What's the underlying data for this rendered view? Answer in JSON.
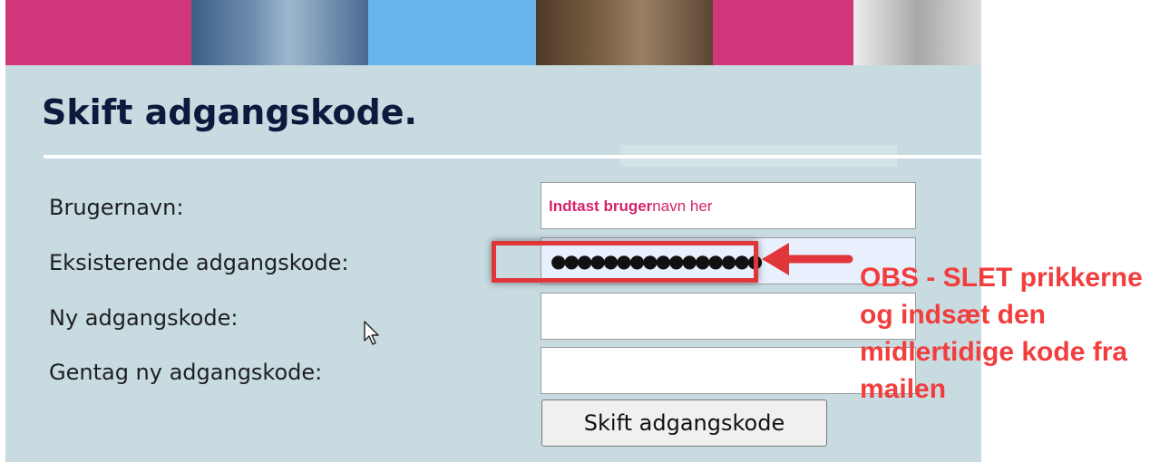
{
  "page": {
    "title": "Skift adgangskode."
  },
  "form": {
    "username": {
      "label": "Brugernavn:",
      "value_prefix": "Indtast bruger",
      "value_suffix": "navn her"
    },
    "current_password": {
      "label": "Eksisterende adgangskode:",
      "masked_value": "●●●●●●●●●●●●●●●●"
    },
    "new_password": {
      "label": "Ny adgangskode:",
      "value": ""
    },
    "repeat_password": {
      "label": "Gentag ny adgangskode:",
      "value": ""
    },
    "submit_label": "Skift adgangskode"
  },
  "annotation": {
    "note": "OBS - SLET prikkerne og indsæt den midlertidige kode fra mailen",
    "color": "#f23d3d"
  },
  "colors": {
    "panel_background": "#c7dbe1",
    "title": "#0d1a3d",
    "username_hint": "#d6226a",
    "banner_pink": "#d0377a",
    "banner_blue": "#68b4ec"
  },
  "icons": {
    "arrow": "arrow-left-icon",
    "cursor": "mouse-pointer-icon"
  }
}
